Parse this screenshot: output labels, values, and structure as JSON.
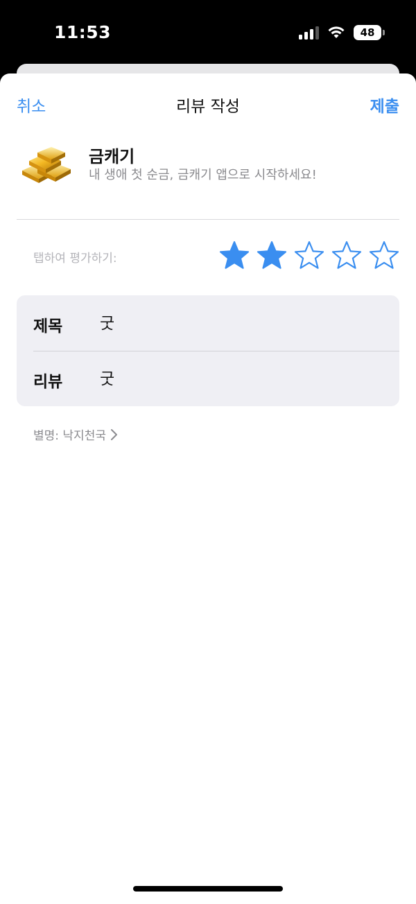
{
  "status_bar": {
    "time": "11:53",
    "battery": "48",
    "icons": [
      "signal-icon",
      "wifi-icon",
      "battery-icon"
    ]
  },
  "nav": {
    "cancel": "취소",
    "title": "리뷰 작성",
    "submit": "제출"
  },
  "app": {
    "icon": "gold-bars-icon",
    "name": "금캐기",
    "subtitle": "내 생애 첫 순금, 금캐기 앱으로 시작하세요!"
  },
  "rating": {
    "label": "탭하여 평가하기:",
    "value": 2,
    "max": 5
  },
  "form": {
    "title_label": "제목",
    "title_value": "굿",
    "review_label": "리뷰",
    "review_value": "굿"
  },
  "nickname": {
    "text": "별명: 낙지천국"
  },
  "colors": {
    "accent": "#3a8ef0",
    "secondary_text": "#8a8a8e",
    "card_bg": "#efeff4"
  }
}
